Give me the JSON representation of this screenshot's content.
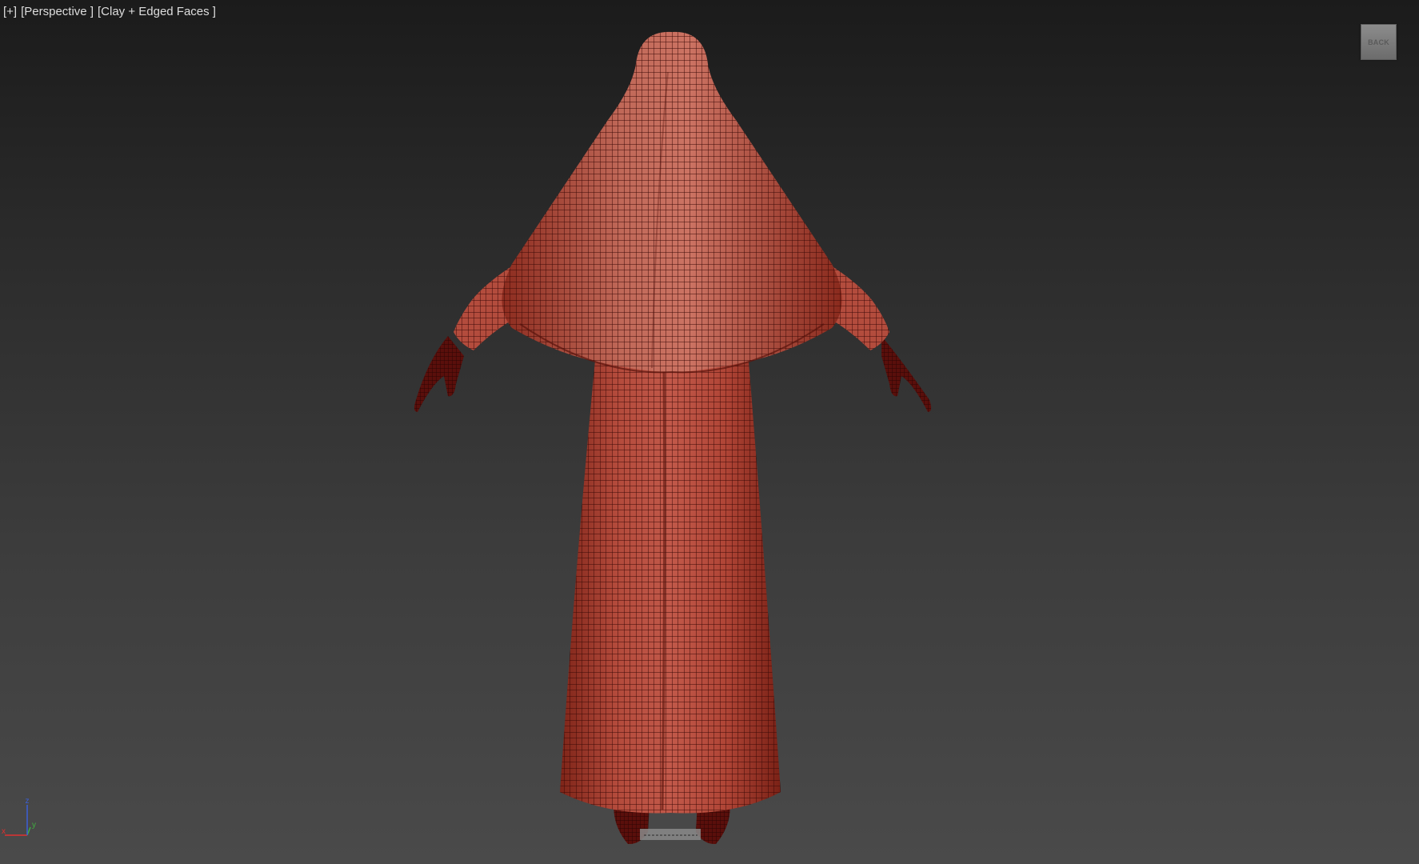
{
  "viewport": {
    "label_plus": "[+]",
    "label_view": "[Perspective ]",
    "label_shading": "[Clay + Edged Faces ]"
  },
  "viewcube": {
    "face_label": "BACK"
  },
  "axis_tripod": {
    "z_label": "z",
    "x_label": "x",
    "y_label": "y",
    "x_color": "#e03030",
    "y_color": "#3fae3f",
    "z_color": "#3a5fd8"
  },
  "scene": {
    "model_color": "#a83a2e",
    "wire_color": "#3a0906",
    "icon": "hooded-robe-mesh"
  }
}
